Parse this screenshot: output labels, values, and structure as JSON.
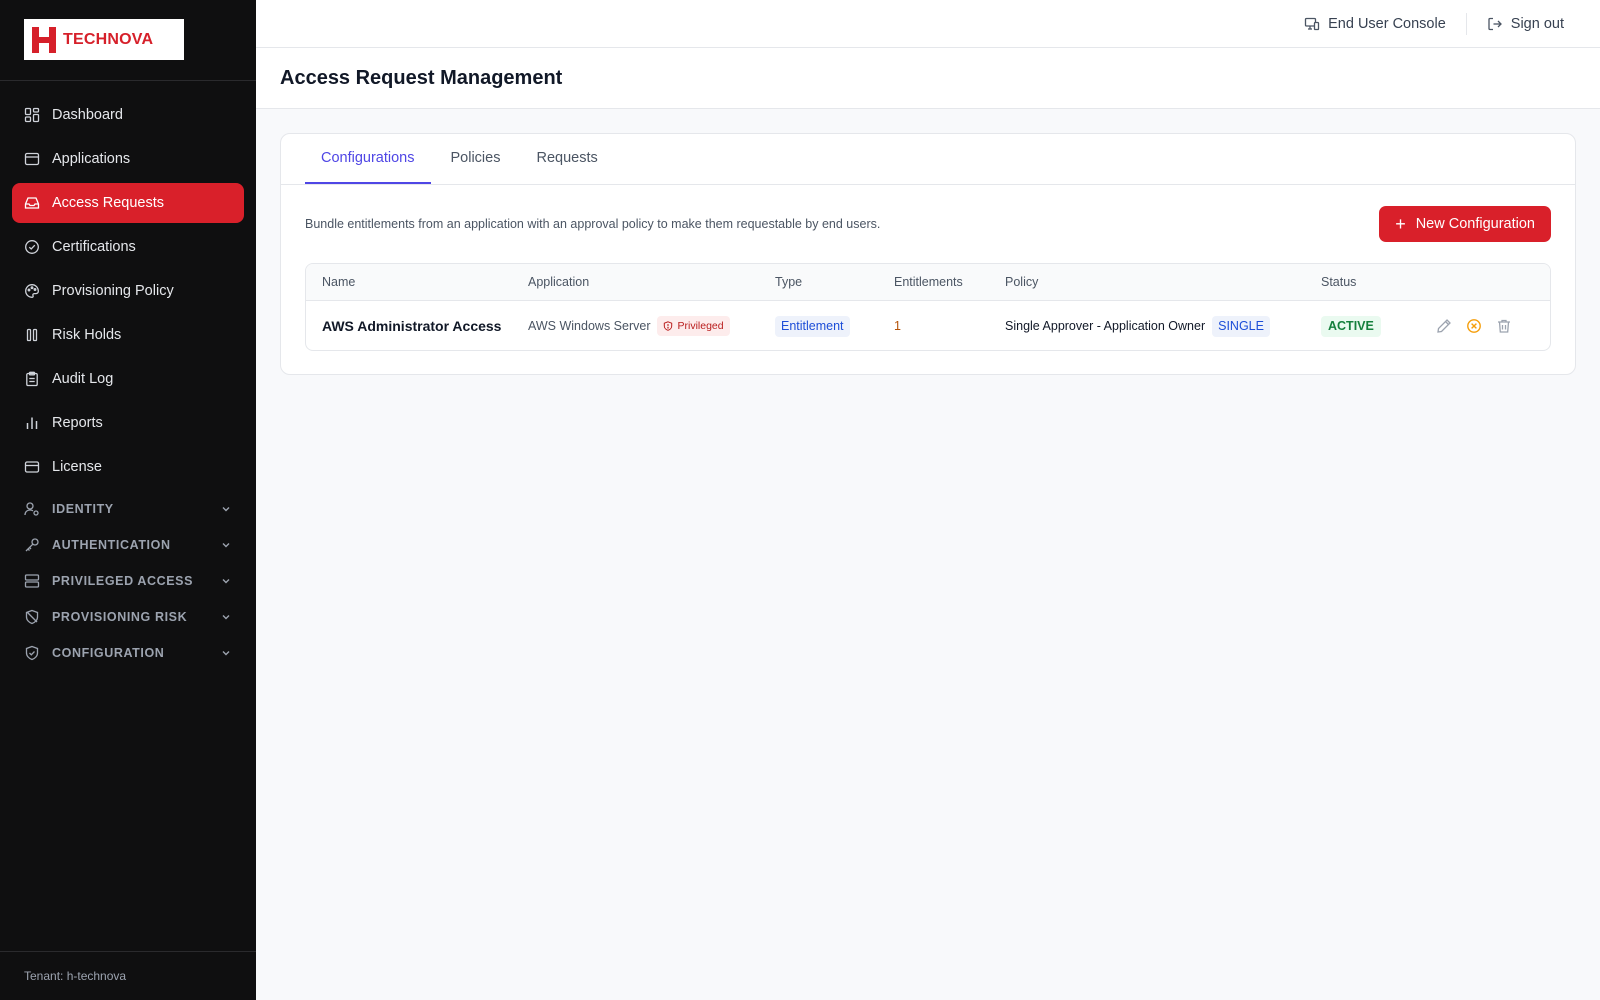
{
  "brand": {
    "name": "TECHNOVA",
    "accent": "#d9202a"
  },
  "sidebar": {
    "items": [
      {
        "label": "Dashboard",
        "icon": "dashboard-grid-icon",
        "active": false
      },
      {
        "label": "Applications",
        "icon": "app-window-icon",
        "active": false
      },
      {
        "label": "Access Requests",
        "icon": "inbox-tray-icon",
        "active": true
      },
      {
        "label": "Certifications",
        "icon": "check-circle-icon",
        "active": false
      },
      {
        "label": "Provisioning Policy",
        "icon": "palette-icon",
        "active": false
      },
      {
        "label": "Risk Holds",
        "icon": "pause-icon",
        "active": false
      },
      {
        "label": "Audit Log",
        "icon": "clipboard-icon",
        "active": false
      },
      {
        "label": "Reports",
        "icon": "bar-chart-icon",
        "active": false
      },
      {
        "label": "License",
        "icon": "credit-card-icon",
        "active": false
      }
    ],
    "sections": [
      {
        "label": "IDENTITY",
        "icon": "user-gear-icon"
      },
      {
        "label": "AUTHENTICATION",
        "icon": "key-icon"
      },
      {
        "label": "PRIVILEGED ACCESS",
        "icon": "server-icon"
      },
      {
        "label": "PROVISIONING RISK",
        "icon": "shield-off-icon"
      },
      {
        "label": "CONFIGURATION",
        "icon": "shield-check-icon"
      }
    ],
    "tenant": "Tenant: h-technova"
  },
  "topbar": {
    "console_label": "End User Console",
    "signout_label": "Sign out"
  },
  "page": {
    "title": "Access Request Management"
  },
  "tabs": [
    {
      "label": "Configurations",
      "active": true
    },
    {
      "label": "Policies",
      "active": false
    },
    {
      "label": "Requests",
      "active": false
    }
  ],
  "toolbar": {
    "description": "Bundle entitlements from an application with an approval policy to make them requestable by end users.",
    "new_button_label": "New Configuration"
  },
  "table": {
    "columns": [
      "Name",
      "Application",
      "Type",
      "Entitlements",
      "Policy",
      "Status"
    ],
    "rows": [
      {
        "name": "AWS Administrator Access",
        "application": "AWS Windows Server",
        "application_badge": "Privileged",
        "type": "Entitlement",
        "entitlements": "1",
        "policy": "Single Approver - Application Owner",
        "policy_badge": "SINGLE",
        "status": "ACTIVE"
      }
    ]
  }
}
